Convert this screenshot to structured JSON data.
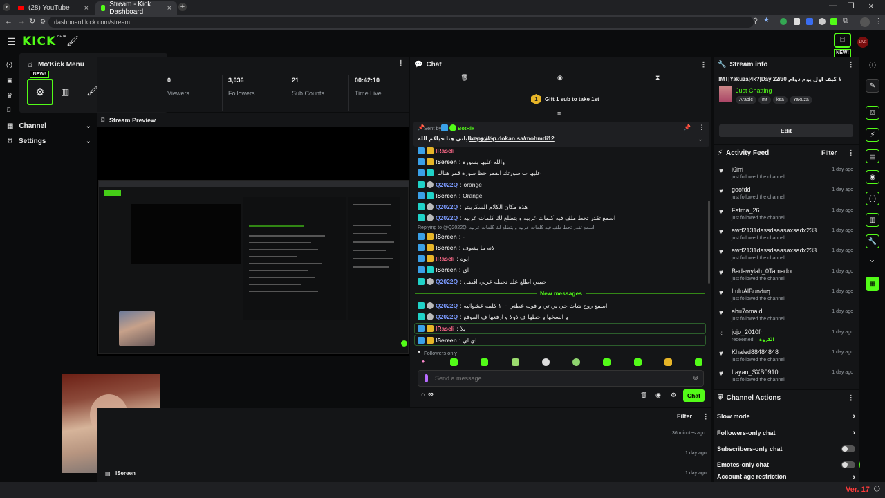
{
  "browser": {
    "tabs": [
      {
        "label": "(28) YouTube",
        "active": false
      },
      {
        "label": "Stream - Kick Dashboard",
        "active": true
      }
    ],
    "url": "dashboard.kick.com/stream"
  },
  "header": {
    "logo": "KICK",
    "logo_sup": "BETA",
    "new_badge": "NEW!"
  },
  "menu_popup": {
    "title": "Mo'Kick Menu",
    "new_badge": "NEW!"
  },
  "sidebar": {
    "channel_label": "Channel",
    "settings_label": "Settings"
  },
  "stats": [
    {
      "value": "0",
      "label": "Viewers"
    },
    {
      "value": "3,036",
      "label": "Followers"
    },
    {
      "value": "21",
      "label": "Sub Counts"
    },
    {
      "value": "00:42:10",
      "label": "Time Live"
    }
  ],
  "stream_preview": {
    "title": "Stream Preview"
  },
  "chat": {
    "title": "Chat",
    "gift_num": "1",
    "gift_text": "Gift 1 sub to take 1st",
    "pinned_sent_by": "Sent by",
    "pinned_user": "BotRix",
    "pinned_prefix": "جميع حساباتي هنا حياكم الله:",
    "pinned_link": "https://tip.dokan.sa/mohmdi12",
    "messages": [
      {
        "user": "IRaseli",
        "text": "",
        "color": "#ff6b8a"
      },
      {
        "user": "ISereen",
        "text": "والله عليها بسوره",
        "color": "#ffffff"
      },
      {
        "user": "",
        "text": "عليها ب سورتك القمر حظ سورة قمر هناك",
        "color": "#ffffff"
      },
      {
        "user": "Q2022Q",
        "text": "orange",
        "color": "#7b9bff"
      },
      {
        "user": "ISereen",
        "text": "Orange",
        "color": "#ffffff"
      },
      {
        "user": "Q2022Q",
        "text": "هذه مكان الكلام السكريبتر",
        "color": "#7b9bff"
      },
      {
        "user": "Q2022Q",
        "text": "اسمع تقدر تحط ملف فيه كلمات عربيه و بتطلع لك كلمات عربيه",
        "color": "#7b9bff"
      },
      {
        "user": "ISereen",
        "text": "-",
        "color": "#ffffff"
      },
      {
        "user": "ISereen",
        "text": "لانه ما يشوف",
        "color": "#ffffff"
      },
      {
        "user": "IRaseli",
        "text": "ايوه",
        "color": "#ff6b8a"
      },
      {
        "user": "ISereen",
        "text": "اي",
        "color": "#ffffff"
      },
      {
        "user": "Q2022Q",
        "text": "حبيبي اطلع علنا نحطه عربي افضل",
        "color": "#7b9bff"
      }
    ],
    "reply_to": "Replying to @Q2022Q: اسمع تقدر تحط ملف فيه كلمات عربيه و بتطلع لك كلمات عربيه",
    "new_messages_label": "New messages",
    "new_messages": [
      {
        "user": "Q2022Q",
        "text": "اسمع روح شات جي بي تي و قوله عطني ١٠٠ كلمه عشوائيه",
        "color": "#7b9bff"
      },
      {
        "user": "Q2022Q",
        "text": "و انسخها و حطها ف ذولا و ارفعها ف الموقع",
        "color": "#7b9bff"
      },
      {
        "user": "IRaseli",
        "text": "يلا",
        "color": "#ff6b8a"
      },
      {
        "user": "ISereen",
        "text": "اي اي",
        "color": "#ffffff"
      }
    ],
    "followers_only": "Followers only",
    "input_placeholder": "Send a message",
    "send_button": "Chat",
    "infinity": "∞"
  },
  "stream_info": {
    "title": "Stream info",
    "stream_title": "!MT|Yakuza|4k?|Day 22/30 ؟ كيف اول يوم دوام",
    "category": "Just Chatting",
    "tags": [
      "Arabic",
      "mt",
      "ksa",
      "Yakuza"
    ],
    "edit_button": "Edit"
  },
  "activity_feed": {
    "title": "Activity Feed",
    "filter_label": "Filter",
    "items": [
      {
        "name": "i6irri",
        "action": "just followed the channel",
        "time": "1 day ago"
      },
      {
        "name": "goofdd",
        "action": "just followed the channel",
        "time": "1 day ago"
      },
      {
        "name": "Fatma_26",
        "action": "just followed the channel",
        "time": "1 day ago"
      },
      {
        "name": "awd2131dassdsaasaxsadx233",
        "action": "just followed the channel",
        "time": "1 day ago"
      },
      {
        "name": "awd2131dassdsaasaxsadx233",
        "action": "just followed the channel",
        "time": "1 day ago"
      },
      {
        "name": "Badawylah_0Tamador",
        "action": "just followed the channel",
        "time": "1 day ago"
      },
      {
        "name": "LuluAlBunduq",
        "action": "just followed the channel",
        "time": "1 day ago"
      },
      {
        "name": "abu7omaid",
        "action": "just followed the channel",
        "time": "1 day ago"
      },
      {
        "name": "jojo_2010frl",
        "action": "redeemed",
        "extra": "الكروة",
        "time": "1 day ago"
      },
      {
        "name": "Khaled88484848",
        "action": "just followed the channel",
        "time": "1 day ago"
      },
      {
        "name": "Layan_SXB0910",
        "action": "just followed the channel",
        "time": "1 day ago"
      }
    ]
  },
  "channel_actions": {
    "title": "Channel Actions",
    "items": [
      {
        "label": "Slow mode",
        "control": "chevron"
      },
      {
        "label": "Followers-only chat",
        "control": "chevron"
      },
      {
        "label": "Subscribers-only chat",
        "control": "toggle"
      },
      {
        "label": "Emotes-only chat",
        "control": "toggle"
      },
      {
        "label": "Account age restriction",
        "control": "chevron"
      }
    ]
  },
  "bottom_feed": {
    "filter_label": "Filter",
    "times": [
      "36 minutes ago",
      "1 day ago",
      "1 day ago"
    ],
    "last_user": "ISereen"
  },
  "version": "Ver. 17"
}
